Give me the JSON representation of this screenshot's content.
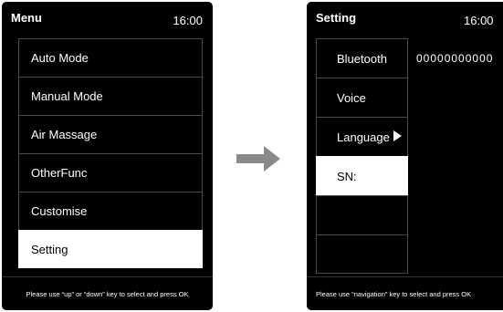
{
  "menu_screen": {
    "title": "Menu",
    "time": "16:00",
    "items": [
      {
        "label": "Auto Mode"
      },
      {
        "label": "Manual Mode"
      },
      {
        "label": "Air Massage"
      },
      {
        "label": "OtherFunc"
      },
      {
        "label": "Customise"
      },
      {
        "label": "Setting",
        "selected": true
      }
    ],
    "footer_text": "Please use “up” or “down” key to select and press OK"
  },
  "setting_screen": {
    "title": "Setting",
    "time": "16:00",
    "items": [
      {
        "label": "Bluetooth"
      },
      {
        "label": "Voice"
      },
      {
        "label": "Language",
        "icon": "play-triangle-icon"
      },
      {
        "label": "SN:",
        "selected": true
      },
      {
        "label": ""
      },
      {
        "label": ""
      }
    ],
    "sn_value": "00000000000",
    "footer_text": "Please use “navigation” key to select and press OK"
  },
  "transition_arrow": {
    "icon": "right-arrow-icon",
    "color": "#8a8a8a"
  },
  "colors": {
    "screen_bg": "#000000",
    "selected_bg": "#ffffff",
    "divider": "#4a4a4a"
  }
}
